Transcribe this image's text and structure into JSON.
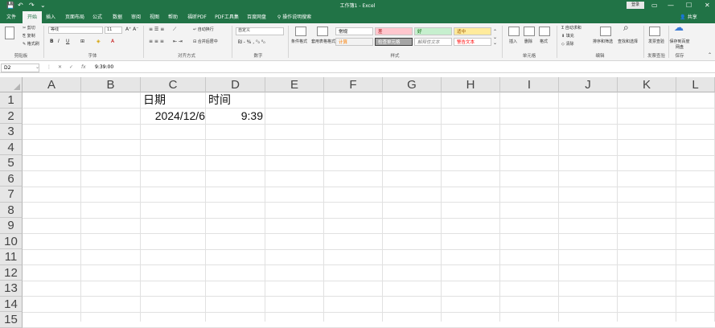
{
  "window": {
    "title": "工作簿1 - Excel",
    "login": "登录",
    "quick_access": [
      "💾",
      "↶",
      "↷",
      "⌄"
    ],
    "controls": [
      "▭",
      "—",
      "☐",
      "✕"
    ]
  },
  "tabs": [
    "文件",
    "开始",
    "插入",
    "页面布局",
    "公式",
    "数据",
    "审阅",
    "视图",
    "帮助",
    "福昕PDF",
    "PDF工具集",
    "百度网盘",
    "操作说明搜索"
  ],
  "tell_me_icon": "lightbulb-icon",
  "share": "共享",
  "ribbon": {
    "clipboard": {
      "cut": "剪切",
      "copy": "复制",
      "format_painter": "格式刷",
      "label": "剪贴板"
    },
    "font": {
      "name": "等线",
      "size": "11",
      "bold": "B",
      "italic": "I",
      "underline": "U",
      "label": "字体"
    },
    "alignment": {
      "wrap": "自动换行",
      "merge": "合并后居中",
      "label": "对齐方式"
    },
    "number": {
      "format": "自定义",
      "label": "数字"
    },
    "styles": {
      "conditional": "条件格式",
      "table": "套用表格格式",
      "cells": [
        "常规",
        "差",
        "好",
        "适中",
        "计算",
        "检查单元格",
        "解释性文本",
        "警告文本"
      ],
      "label": "样式"
    },
    "cells": {
      "insert": "插入",
      "delete": "删除",
      "format": "格式",
      "label": "单元格"
    },
    "editing": {
      "autosum": "自动求和",
      "fill": "填充",
      "clear": "清除",
      "sort": "排序和筛选",
      "find": "查找和选择",
      "label": "编辑"
    },
    "invoice": {
      "check": "发票查验",
      "label": "发票查验"
    },
    "save": {
      "baidu": "保存到百度网盘",
      "label": "保存"
    }
  },
  "formula_bar": {
    "name_box": "D2",
    "cancel": "✕",
    "enter": "✓",
    "fx": "fx",
    "value": "9:39:00"
  },
  "columns": [
    "A",
    "B",
    "C",
    "D",
    "E",
    "F",
    "G",
    "H",
    "I",
    "J",
    "K",
    "L"
  ],
  "rows": [
    "1",
    "2",
    "3",
    "4",
    "5",
    "6",
    "7",
    "8",
    "9",
    "10",
    "11",
    "12",
    "13",
    "14",
    "15"
  ],
  "cells": {
    "C1": "日期",
    "D1": "时间",
    "C2": "2024/12/6",
    "D2": "9:39"
  }
}
